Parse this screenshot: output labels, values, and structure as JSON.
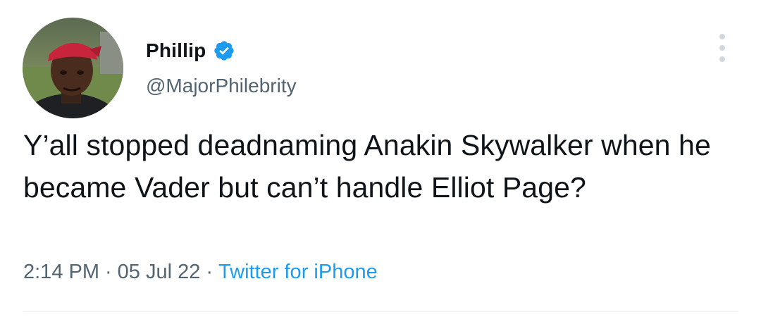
{
  "tweet": {
    "display_name": "Phillip",
    "handle": "@MajorPhilebrity",
    "text": "Y’all stopped deadnaming Anakin Skywalker when he became Vader but can’t handle Elliot Page?",
    "time": "2:14 PM",
    "date": "05 Jul 22",
    "separator": "·",
    "source": "Twitter for iPhone"
  },
  "icons": {
    "verified": "verified-badge-icon",
    "more": "more-options-icon"
  },
  "colors": {
    "accent": "#1d9bf0",
    "text": "#0f1419",
    "secondary": "#536471",
    "divider": "#eff3f4"
  }
}
